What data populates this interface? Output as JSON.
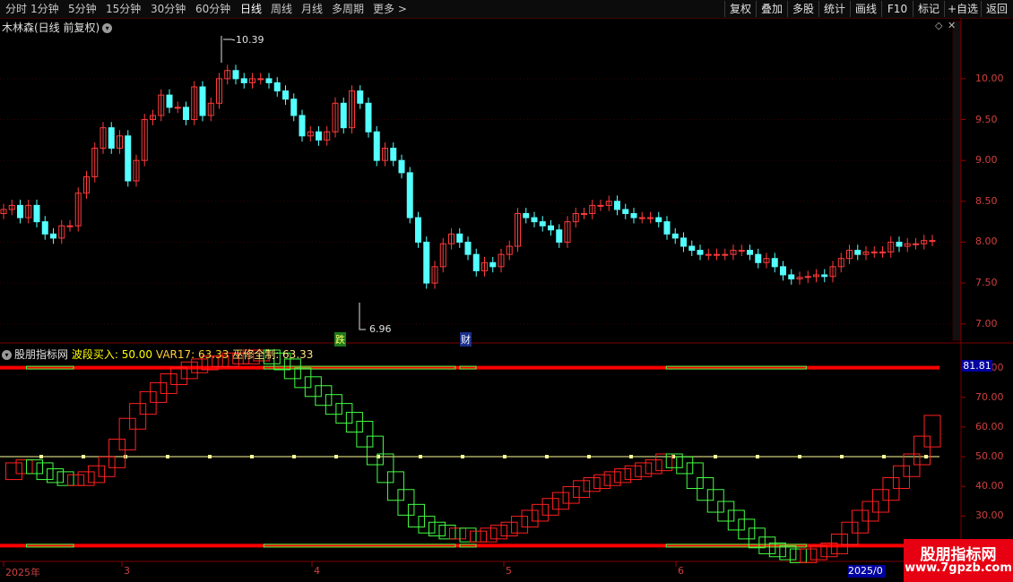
{
  "toolbar": {
    "periods": [
      "分时",
      "1分钟",
      "5分钟",
      "15分钟",
      "30分钟",
      "60分钟",
      "日线",
      "周线",
      "月线",
      "多周期",
      "更多"
    ],
    "active_period": "日线",
    "right_buttons": [
      "复权",
      "叠加",
      "多股",
      "统计",
      "画线",
      "F10",
      "标记",
      "+自选",
      "返回"
    ]
  },
  "chart_header": {
    "title": "木林森(日线 前复权)",
    "high_label": "10.39",
    "low_label": "6.96",
    "event_flags": [
      "跌",
      "财"
    ]
  },
  "price_axis": [
    "10.00",
    "9.50",
    "9.00",
    "8.50",
    "8.00",
    "7.50",
    "7.00"
  ],
  "indicator": {
    "name": "股朋指标网",
    "line1": "波段买入: 50.00",
    "line2": "VAR17: 63.33",
    "line3": "巫修全制: 63.33",
    "current_value": "81.81",
    "axis": [
      "80.00",
      "70.00",
      "60.00",
      "50.00",
      "40.00",
      "30.00",
      "20.00"
    ]
  },
  "time_axis": {
    "labels": [
      "2025年",
      "3",
      "4",
      "5",
      "6"
    ],
    "cursor_date": "2025/0"
  },
  "watermark": {
    "line1": "股朋指标网",
    "line2": "www.7gpzb.com"
  },
  "colors": {
    "up": "#ff3b3b",
    "down": "#54ffff",
    "osc_up": "#ff2020",
    "osc_down": "#44ff44",
    "threshold": "#ff0000",
    "mid_line": "#ffff99"
  },
  "chart_data": [
    {
      "type": "candlestick",
      "title": "木林森(日线 前复权)",
      "ylim": [
        6.8,
        10.7
      ],
      "x": [
        "2025-02",
        "2025-03",
        "2025-04",
        "2025-05",
        "2025-06"
      ],
      "closes": [
        8.4,
        8.45,
        8.3,
        8.45,
        8.25,
        8.1,
        8.05,
        8.2,
        8.2,
        8.6,
        8.8,
        9.15,
        9.4,
        9.15,
        9.3,
        8.75,
        9.0,
        9.5,
        9.55,
        9.8,
        9.65,
        9.65,
        9.5,
        9.9,
        9.55,
        9.7,
        10.0,
        10.1,
        10.0,
        9.95,
        10.0,
        10.0,
        9.95,
        9.85,
        9.75,
        9.55,
        9.3,
        9.35,
        9.25,
        9.35,
        9.7,
        9.4,
        9.85,
        9.7,
        9.35,
        9.0,
        9.15,
        9.0,
        8.85,
        8.3,
        8.0,
        7.5,
        7.7,
        7.98,
        8.1,
        8.0,
        7.85,
        7.65,
        7.75,
        7.7,
        7.85,
        7.95,
        8.35,
        8.3,
        8.25,
        8.2,
        8.15,
        8.0,
        8.25,
        8.35,
        8.35,
        8.45,
        8.45,
        8.5,
        8.4,
        8.35,
        8.3,
        8.3,
        8.3,
        8.25,
        8.1,
        8.05,
        7.95,
        7.9,
        7.85,
        7.85,
        7.85,
        7.85,
        7.9,
        7.9,
        7.85,
        7.75,
        7.8,
        7.7,
        7.6,
        7.55,
        7.57,
        7.58,
        7.6,
        7.58,
        7.7,
        7.8,
        7.9,
        7.85,
        7.88,
        7.88,
        7.88,
        8.0,
        7.95,
        7.98,
        7.98,
        8.02,
        8.02
      ]
    },
    {
      "type": "line",
      "title": "股朋指标网",
      "ylim": [
        15,
        85
      ],
      "series": [
        {
          "name": "VAR17",
          "values": [
            45,
            47,
            48,
            47,
            45,
            44,
            43,
            43,
            44,
            46,
            49,
            55,
            62,
            67,
            71,
            74,
            77,
            79,
            81,
            82,
            83,
            83,
            84,
            84,
            85,
            85,
            84,
            82,
            79,
            76,
            73,
            70,
            67,
            64,
            61,
            56,
            50,
            44,
            38,
            33,
            29,
            27,
            26,
            25,
            25,
            24,
            24,
            25,
            26,
            27,
            29,
            31,
            33,
            35,
            37,
            39,
            41,
            42,
            43,
            44,
            45,
            46,
            47,
            48,
            50,
            49,
            47,
            42,
            38,
            34,
            31,
            28,
            25,
            22,
            20,
            19,
            18,
            17,
            18,
            19,
            20,
            23,
            27,
            31,
            34,
            38,
            42,
            46,
            50,
            56,
            63
          ]
        },
        {
          "name": "波段买入",
          "values": [
            50
          ]
        }
      ]
    }
  ]
}
